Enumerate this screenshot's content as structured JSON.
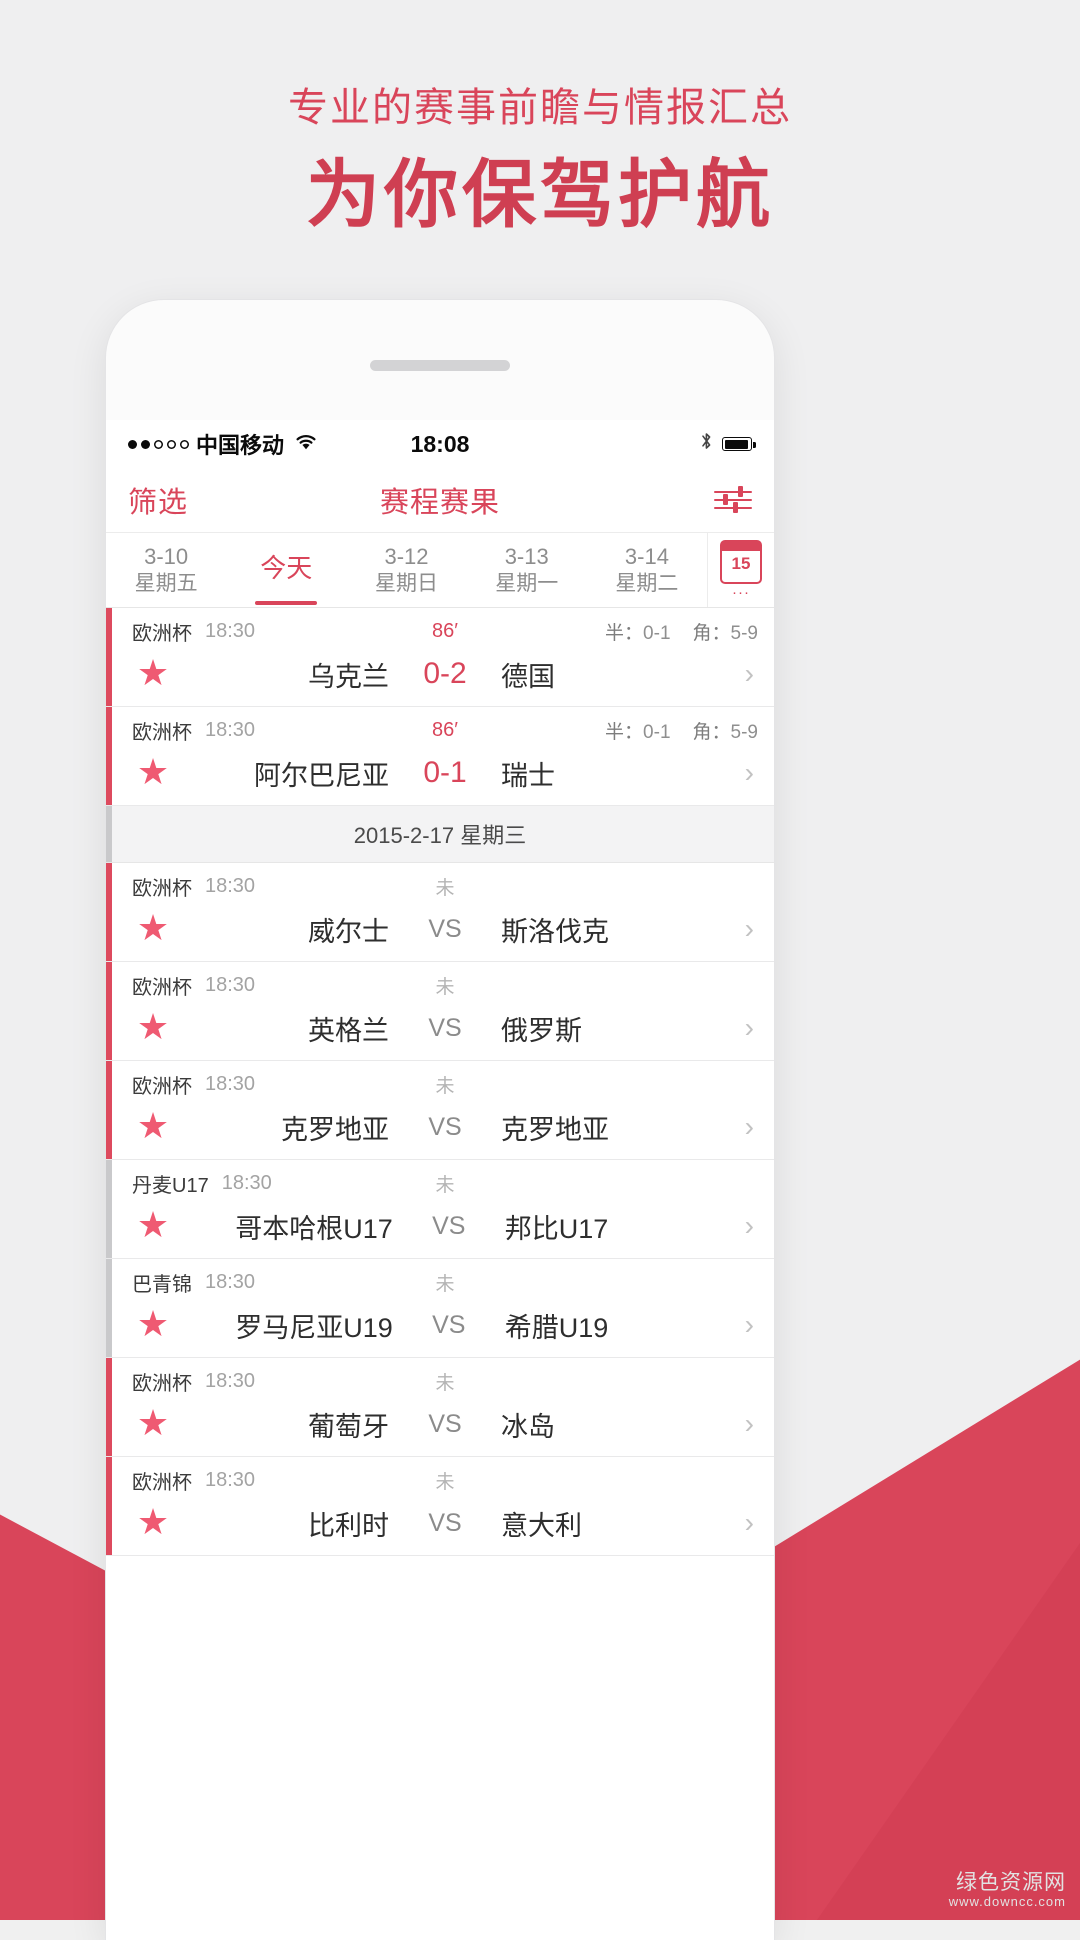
{
  "promo": {
    "subtitle": "专业的赛事前瞻与情报汇总",
    "title": "为你保驾护航",
    "accent_color": "#d9455a",
    "background_color": "#efeff0"
  },
  "status_bar": {
    "signal_dots_filled": 2,
    "signal_dots_total": 5,
    "carrier": "中国移动",
    "wifi_icon": "wifi-icon",
    "time": "18:08",
    "bluetooth_icon": "bluetooth-icon",
    "battery_icon": "battery-icon",
    "battery_level_percent": 92
  },
  "nav_bar": {
    "left_label": "筛选",
    "title": "赛程赛果",
    "right_icon": "sliders-icon"
  },
  "date_tabs": {
    "items": [
      {
        "date": "3-10",
        "weekday": "星期五",
        "active": false
      },
      {
        "date": "今天",
        "weekday": "",
        "active": true
      },
      {
        "date": "3-12",
        "weekday": "星期日",
        "active": false
      },
      {
        "date": "3-13",
        "weekday": "星期一",
        "active": false
      },
      {
        "date": "3-14",
        "weekday": "星期二",
        "active": false
      }
    ],
    "calendar_button": {
      "icon": "calendar-icon",
      "day": "15",
      "more": "···"
    }
  },
  "list": {
    "separator_label": "2015-2-17 星期三",
    "stat_labels": {
      "half": "半：",
      "corner": "角："
    },
    "matches_before_separator": [
      {
        "league": "欧洲杯",
        "time": "18:30",
        "minute": "86′",
        "live": true,
        "home": "乌克兰",
        "score": "0-2",
        "away": "德国",
        "half": "0-1",
        "corner": "5-9",
        "favorite": true,
        "bar": "red",
        "chevron": "chevron-right-icon"
      },
      {
        "league": "欧洲杯",
        "time": "18:30",
        "minute": "86′",
        "live": true,
        "home": "阿尔巴尼亚",
        "score": "0-1",
        "away": "瑞士",
        "half": "0-1",
        "corner": "5-9",
        "favorite": true,
        "bar": "red",
        "chevron": "chevron-right-icon"
      }
    ],
    "matches_after_separator": [
      {
        "league": "欧洲杯",
        "time": "18:30",
        "minute": "未",
        "live": false,
        "home": "威尔士",
        "score": "VS",
        "away": "斯洛伐克",
        "half": "",
        "corner": "",
        "favorite": true,
        "bar": "red",
        "chevron": "chevron-right-icon"
      },
      {
        "league": "欧洲杯",
        "time": "18:30",
        "minute": "未",
        "live": false,
        "home": "英格兰",
        "score": "VS",
        "away": "俄罗斯",
        "half": "",
        "corner": "",
        "favorite": true,
        "bar": "red",
        "chevron": "chevron-right-icon"
      },
      {
        "league": "欧洲杯",
        "time": "18:30",
        "minute": "未",
        "live": false,
        "home": "克罗地亚",
        "score": "VS",
        "away": "克罗地亚",
        "half": "",
        "corner": "",
        "favorite": true,
        "bar": "red",
        "chevron": "chevron-right-icon"
      },
      {
        "league": "丹麦U17",
        "time": "18:30",
        "minute": "未",
        "live": false,
        "home": "哥本哈根U17",
        "score": "VS",
        "away": "邦比U17",
        "half": "",
        "corner": "",
        "favorite": true,
        "bar": "gray",
        "chevron": "chevron-right-icon"
      },
      {
        "league": "巴青锦",
        "time": "18:30",
        "minute": "未",
        "live": false,
        "home": "罗马尼亚U19",
        "score": "VS",
        "away": "希腊U19",
        "half": "",
        "corner": "",
        "favorite": true,
        "bar": "gray",
        "chevron": "chevron-right-icon"
      },
      {
        "league": "欧洲杯",
        "time": "18:30",
        "minute": "未",
        "live": false,
        "home": "葡萄牙",
        "score": "VS",
        "away": "冰岛",
        "half": "",
        "corner": "",
        "favorite": true,
        "bar": "red",
        "chevron": "chevron-right-icon"
      },
      {
        "league": "欧洲杯",
        "time": "18:30",
        "minute": "未",
        "live": false,
        "home": "比利时",
        "score": "VS",
        "away": "意大利",
        "half": "",
        "corner": "",
        "favorite": true,
        "bar": "red",
        "chevron": "chevron-right-icon"
      }
    ]
  },
  "watermark": {
    "line1": "绿色资源网",
    "line2": "www.downcc.com"
  }
}
